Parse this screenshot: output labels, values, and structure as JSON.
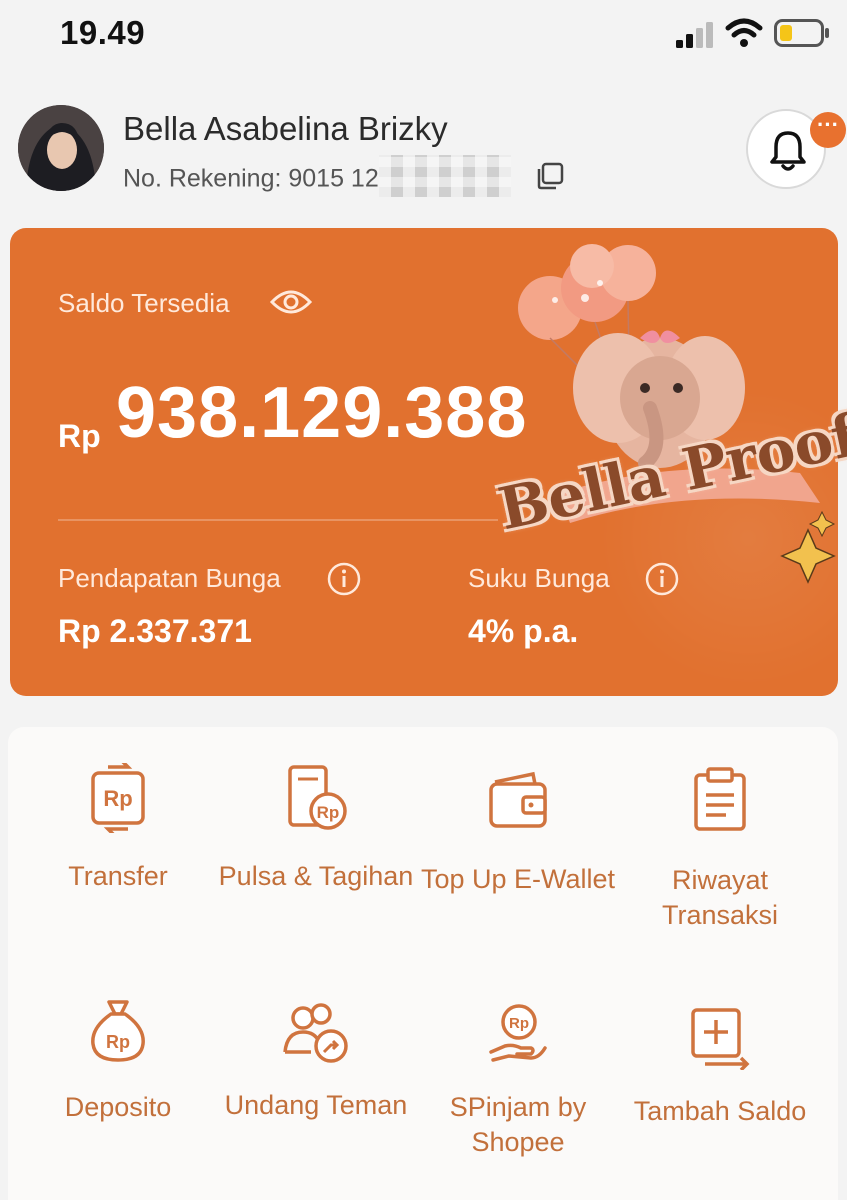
{
  "status_bar": {
    "time": "19.49"
  },
  "profile": {
    "name": "Bella Asabelina Brizky",
    "account_prefix": "No. Rekening: 9015 12"
  },
  "notifications": {
    "badge": "···"
  },
  "balance": {
    "label": "Saldo Tersedia",
    "currency": "Rp",
    "amount": "938.129.388",
    "interest_label": "Pendapatan Bunga",
    "interest_value": "Rp 2.337.371",
    "rate_label": "Suku Bunga",
    "rate_value": "4% p.a."
  },
  "sticker": {
    "text": "Bella Proof"
  },
  "menu": [
    {
      "label": "Transfer",
      "icon": "transfer-rp-icon"
    },
    {
      "label": "Pulsa & Tagihan",
      "icon": "bill-rp-icon"
    },
    {
      "label": "Top Up E-Wallet",
      "icon": "wallet-icon"
    },
    {
      "label": "Riwayat Transaksi",
      "icon": "clipboard-icon"
    },
    {
      "label": "Deposito",
      "icon": "money-bag-icon"
    },
    {
      "label": "Undang Teman",
      "icon": "invite-friends-icon"
    },
    {
      "label": "SPinjam by Shopee",
      "icon": "loan-hand-icon"
    },
    {
      "label": "Tambah Saldo",
      "icon": "add-balance-icon"
    }
  ],
  "colors": {
    "accent": "#e1712f",
    "menu_text": "#c2703b"
  }
}
